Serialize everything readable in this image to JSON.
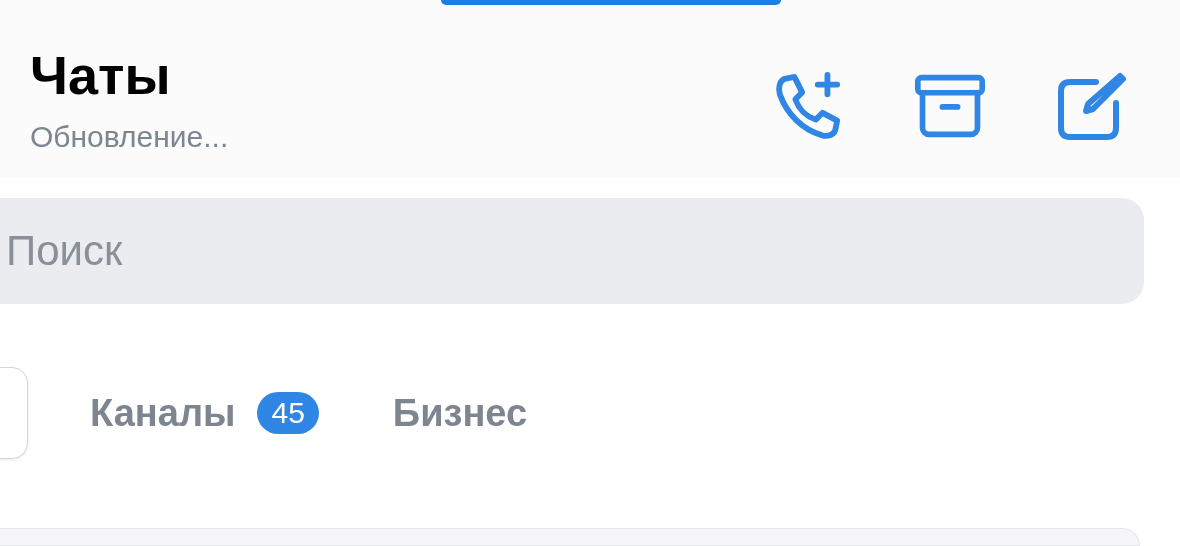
{
  "header": {
    "title": "Чаты",
    "subtitle": "Обновление..."
  },
  "search": {
    "placeholder": "Поиск"
  },
  "tabs": [
    {
      "selected": true
    },
    {
      "label": "Каналы",
      "badge": "45",
      "selected": false
    },
    {
      "label": "Бизнес",
      "selected": false
    }
  ]
}
